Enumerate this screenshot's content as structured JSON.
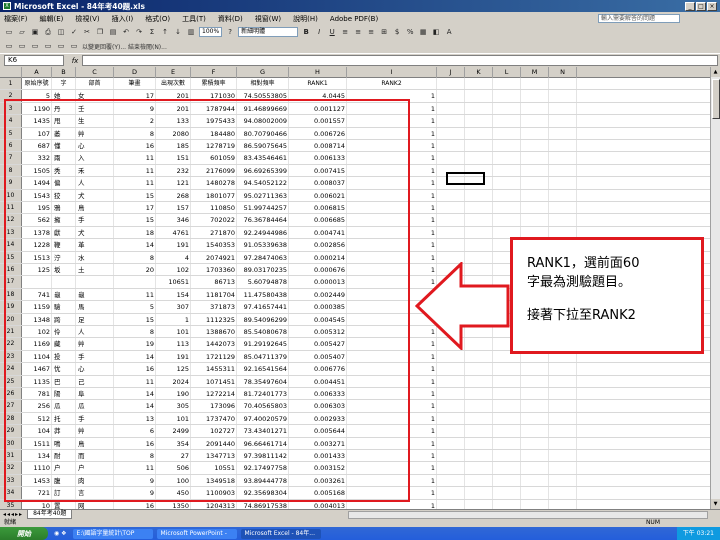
{
  "window": {
    "title": "Microsoft Excel - 84年考40題.xls",
    "controls": [
      "_",
      "□",
      "×"
    ]
  },
  "menu": {
    "items": [
      "檔案(F)",
      "編輯(E)",
      "檢視(V)",
      "插入(I)",
      "格式(O)",
      "工具(T)",
      "資料(D)",
      "視窗(W)",
      "說明(H)",
      "Adobe PDF(B)"
    ],
    "help_placeholder": "輸入需要解答的問題"
  },
  "toolbar": {
    "zoom": "100%",
    "font": "新細明體",
    "review_text": "以變更回覆(Y)... 結束檢閱(N)..."
  },
  "formula_bar": {
    "name_box": "K6",
    "fx": "fx",
    "value": ""
  },
  "columns": [
    "A",
    "B",
    "C",
    "D",
    "E",
    "F",
    "G",
    "H",
    "I",
    "J",
    "K",
    "L",
    "M",
    "N"
  ],
  "header_row": [
    "原始序號",
    "字",
    "部首",
    "筆畫",
    "出現次數",
    "累積頻率",
    "相對頻率",
    "RANK1",
    "RANK2"
  ],
  "rows": [
    [
      "5",
      "她",
      "女",
      "17",
      "201",
      "171030",
      "74.50553805",
      "4.0445"
    ],
    [
      "1190",
      "丹",
      "壬",
      "9",
      "201",
      "1787944",
      "91.46899669",
      "0.001127"
    ],
    [
      "1435",
      "甩",
      "生",
      "2",
      "133",
      "1975433",
      "94.08002009",
      "0.001557"
    ],
    [
      "107",
      "萎",
      "艸",
      "8",
      "2080",
      "184480",
      "80.70790466",
      "0.006726"
    ],
    [
      "687",
      "懂",
      "心",
      "16",
      "185",
      "1278719",
      "86.59075645",
      "0.008714"
    ],
    [
      "332",
      "兩",
      "入",
      "11",
      "151",
      "601059",
      "83.43546461",
      "0.006133"
    ],
    [
      "1505",
      "秃",
      "禾",
      "11",
      "232",
      "2176099",
      "96.69265399",
      "0.007415"
    ],
    [
      "1494",
      "偏",
      "人",
      "11",
      "121",
      "1480278",
      "94.54052122",
      "0.008037"
    ],
    [
      "1543",
      "狡",
      "犬",
      "15",
      "268",
      "1801077",
      "95.02711363",
      "0.006021"
    ],
    [
      "195",
      "鴉",
      "鳥",
      "17",
      "157",
      "110850",
      "51.99744257",
      "0.006815"
    ],
    [
      "562",
      "擁",
      "手",
      "15",
      "346",
      "702022",
      "76.36784464",
      "0.006685"
    ],
    [
      "1378",
      "獻",
      "犬",
      "18",
      "4761",
      "271870",
      "92.24944986",
      "0.004741"
    ],
    [
      "1228",
      "鞭",
      "革",
      "14",
      "191",
      "1540353",
      "91.05339638",
      "0.002856"
    ],
    [
      "1513",
      "泞",
      "水",
      "8",
      "4",
      "2074921",
      "97.28474063",
      "0.000214"
    ],
    [
      "125",
      "坂",
      "土",
      "20",
      "102",
      "1703360",
      "89.03170235",
      "0.000676"
    ],
    [
      "",
      "",
      "",
      "",
      "10651",
      "86713",
      "5.60794878",
      "0.000013"
    ],
    [
      "741",
      "龜",
      "龜",
      "11",
      "154",
      "1181704",
      "11.47580438",
      "0.002449"
    ],
    [
      "1159",
      "驗",
      "馬",
      "5",
      "307",
      "371873",
      "97.41657441",
      "0.000385"
    ],
    [
      "1348",
      "跨",
      "足",
      "15",
      "1",
      "1112325",
      "89.54096299",
      "0.004545"
    ],
    [
      "102",
      "伶",
      "人",
      "8",
      "101",
      "1388670",
      "85.54080678",
      "0.005312"
    ],
    [
      "1169",
      "藏",
      "艸",
      "19",
      "113",
      "1442073",
      "91.29192645",
      "0.005427"
    ],
    [
      "1104",
      "投",
      "手",
      "14",
      "191",
      "1721129",
      "85.04711379",
      "0.005407"
    ],
    [
      "1467",
      "忧",
      "心",
      "16",
      "125",
      "1455311",
      "92.16541564",
      "0.006776"
    ],
    [
      "1135",
      "巴",
      "己",
      "11",
      "2024",
      "1071451",
      "78.35497604",
      "0.004451"
    ],
    [
      "781",
      "陽",
      "阜",
      "14",
      "190",
      "1272214",
      "81.72401773",
      "0.006333"
    ],
    [
      "256",
      "瓜",
      "瓜",
      "14",
      "305",
      "173096",
      "70.40565803",
      "0.006303"
    ],
    [
      "512",
      "托",
      "手",
      "13",
      "101",
      "1737470",
      "97.40020579",
      "0.002933"
    ],
    [
      "104",
      "莽",
      "艸",
      "6",
      "2499",
      "102727",
      "73.43401271",
      "0.005644"
    ],
    [
      "1511",
      "鳴",
      "鳥",
      "16",
      "354",
      "2091440",
      "96.66461714",
      "0.003271"
    ],
    [
      "134",
      "耐",
      "而",
      "8",
      "27",
      "1347713",
      "97.39811142",
      "0.001433"
    ],
    [
      "1110",
      "户",
      "户",
      "11",
      "506",
      "10551",
      "92.17497758",
      "0.003152"
    ],
    [
      "1453",
      "腹",
      "肉",
      "9",
      "100",
      "1349518",
      "93.89444778",
      "0.003261"
    ],
    [
      "721",
      "訂",
      "言",
      "9",
      "450",
      "1100903",
      "92.35698304",
      "0.005168"
    ],
    [
      "10",
      "置",
      "网",
      "16",
      "1350",
      "1204313",
      "74.86917538",
      "0.004013"
    ]
  ],
  "sheet_tab": "84年考40題",
  "status_text": "就緒",
  "status_right": "NUM",
  "taskbar": {
    "start": "開始",
    "buttons": [
      "E:\\國語字量統計\\TOP",
      "Microsoft PowerPoint -",
      "Microsoft Excel - 84年..."
    ],
    "clock": "下午 03:21"
  },
  "callout": {
    "line1": "RANK1，選前面60",
    "line2": "字最為測驗題目。",
    "line3": "接著下拉至RANK2"
  },
  "colors": {
    "highlight_red": "#e0191f",
    "titlebar": "#0a246a",
    "taskbar_blue": "#245edb"
  }
}
